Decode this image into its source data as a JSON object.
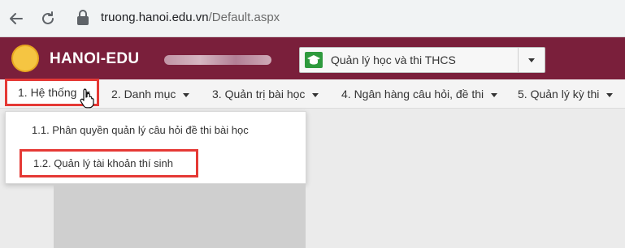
{
  "browser": {
    "url_host": "truong.hanoi.edu.vn",
    "url_path": "/Default.aspx"
  },
  "header": {
    "brand": "HANOI-EDU",
    "system_select": {
      "selected": "Quản lý học và thi THCS"
    }
  },
  "menu": {
    "items": [
      {
        "label": "1. Hệ thống"
      },
      {
        "label": "2. Danh mục"
      },
      {
        "label": "3. Quản trị bài học"
      },
      {
        "label": "4. Ngân hàng câu hỏi, đề thi"
      },
      {
        "label": "5. Quản lý kỳ thi"
      }
    ]
  },
  "dropdown": {
    "items": [
      {
        "label": "1.1. Phân quyền quản lý câu hỏi đề thi bài học"
      },
      {
        "label": "1.2. Quản lý tài khoản thí sinh"
      }
    ]
  },
  "colors": {
    "header_bg": "#7a1f3b",
    "highlight_border": "#e53935",
    "system_icon": "#2e9a3d"
  }
}
